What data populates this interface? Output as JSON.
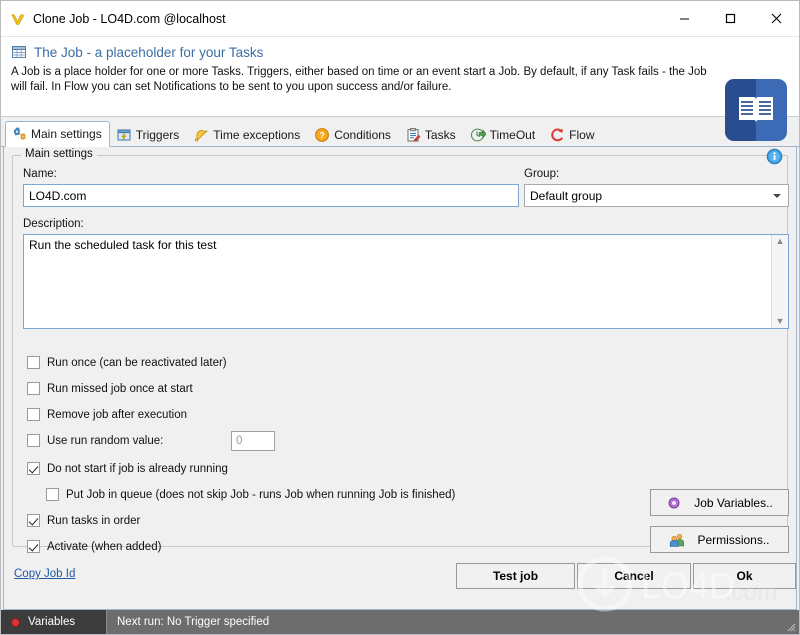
{
  "window": {
    "title": "Clone Job - LO4D.com @localhost",
    "icon": "v-logo-icon",
    "controls": {
      "minimize": "minimize-icon",
      "maximize": "maximize-icon",
      "close": "close-icon"
    }
  },
  "banner": {
    "icon": "table-icon",
    "title": "The Job - a placeholder for your Tasks",
    "description": "A Job is a place holder for one or more Tasks. Triggers, either based on time or an event start a Job. By default, if any Task fails - the Job will fail. In Flow you can set Notifications to be sent to you upon success and/or failure.",
    "logo_icon": "open-book-icon",
    "logo_color": "#2a4d8f"
  },
  "tabs": [
    {
      "label": "Main settings",
      "icon": "gears-icon",
      "active": true
    },
    {
      "label": "Triggers",
      "icon": "trigger-icon",
      "active": false
    },
    {
      "label": "Time exceptions",
      "icon": "bell-icon",
      "active": false
    },
    {
      "label": "Conditions",
      "icon": "question-icon",
      "active": false
    },
    {
      "label": "Tasks",
      "icon": "clipboard-icon",
      "active": false
    },
    {
      "label": "TimeOut",
      "icon": "timeout-icon",
      "active": false
    },
    {
      "label": "Flow",
      "icon": "flow-icon",
      "active": false
    }
  ],
  "main_settings": {
    "group_title": "Main settings",
    "info_icon": "info-icon",
    "name_label": "Name:",
    "name_value": "LO4D.com",
    "name_placeholder": "",
    "group_label": "Group:",
    "group_value": "Default group",
    "description_label": "Description:",
    "description_value": "Run the scheduled task for this test",
    "description_placeholder": "",
    "checkboxes": [
      {
        "label": "Run once (can be reactivated later)",
        "checked": false,
        "indent": 0
      },
      {
        "label": "Run missed job once at start",
        "checked": false,
        "indent": 0
      },
      {
        "label": "Remove job after execution",
        "checked": false,
        "indent": 0
      },
      {
        "label": "Use run random value:",
        "checked": false,
        "indent": 0
      },
      {
        "label": "Do not start if job is already running",
        "checked": true,
        "indent": 0
      },
      {
        "label": "Put Job in queue (does not skip Job - runs Job when running Job is finished)",
        "checked": false,
        "indent": 1
      },
      {
        "label": "Run tasks in order",
        "checked": true,
        "indent": 0
      },
      {
        "label": "Activate (when added)",
        "checked": true,
        "indent": 0
      }
    ],
    "random_value": "0",
    "side_buttons": [
      {
        "label": "Job Variables..",
        "icon": "variable-dot-icon"
      },
      {
        "label": "Permissions..",
        "icon": "users-icon"
      }
    ]
  },
  "footer": {
    "copy_job_id": "Copy Job Id",
    "buttons": [
      {
        "label": "Test job"
      },
      {
        "label": "Cancel"
      },
      {
        "label": "Ok"
      }
    ]
  },
  "statusbar": {
    "variables_label": "Variables",
    "variables_icon": "red-dot-icon",
    "next_run": "Next run: No Trigger specified"
  },
  "watermark": {
    "text": "LO4D.com"
  }
}
